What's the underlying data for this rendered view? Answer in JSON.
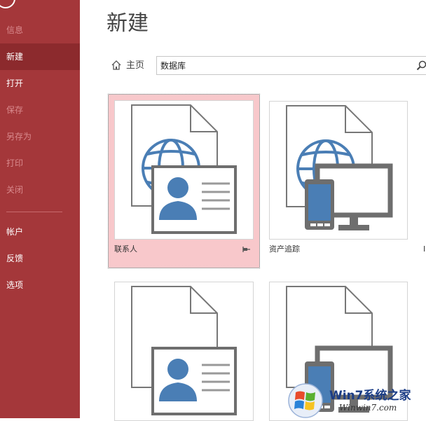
{
  "sidebar": {
    "items": [
      {
        "label": "信息",
        "state": "disabled"
      },
      {
        "label": "新建",
        "state": "selected"
      },
      {
        "label": "打开",
        "state": "normal"
      },
      {
        "label": "保存",
        "state": "disabled"
      },
      {
        "label": "另存为",
        "state": "disabled"
      },
      {
        "label": "打印",
        "state": "disabled"
      },
      {
        "label": "关闭",
        "state": "disabled"
      },
      {
        "label": "帐户",
        "state": "normal"
      },
      {
        "label": "反馈",
        "state": "normal"
      },
      {
        "label": "选项",
        "state": "normal"
      }
    ]
  },
  "main": {
    "title": "新建",
    "breadcrumb": {
      "home_label": "主页"
    },
    "search": {
      "value": "数据库"
    },
    "templates": [
      {
        "label": "联系人",
        "icon": "contacts-template-icon",
        "selected": true,
        "pinnable": true
      },
      {
        "label": "资产追踪",
        "icon": "asset-tracking-template-icon",
        "selected": false
      },
      {
        "label": "",
        "icon": "contacts-template-icon",
        "selected": false
      },
      {
        "label": "",
        "icon": "device-template-icon",
        "selected": false
      }
    ],
    "partial_next_label": "I"
  },
  "watermark": {
    "title": "Win7系统之家",
    "url": "Winwin7.com"
  },
  "colors": {
    "accent": "#a4373a",
    "accent_selected": "#8c2a2d",
    "tile_selected_bg": "#f8c8cb",
    "icon_blue": "#4a7eb5",
    "icon_gray": "#6e6e6e"
  }
}
